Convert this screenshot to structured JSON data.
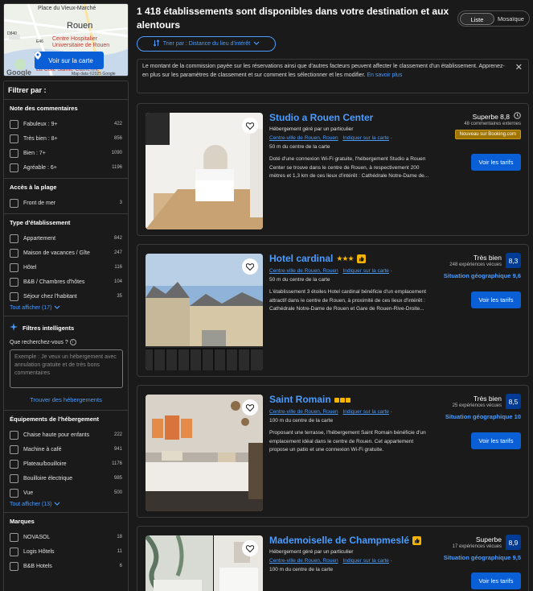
{
  "map": {
    "city": "Rouen",
    "labels": [
      "Place du Vieux-Marché",
      "Centre Hospitalier Universitaire de Rouen",
      "La Côte Sainte-Catherine",
      "Map data ©2025 Google",
      "Google",
      "D840",
      "E46"
    ],
    "button": "Voir sur la carte"
  },
  "header": {
    "title": "1 418 établissements sont disponibles dans votre destination et aux alentours",
    "view_list": "Liste",
    "view_grid": "Mosaïque",
    "sort": "Trier par : Distance du lieu d'intérêt"
  },
  "notice": {
    "text": "Le montant de la commission payée sur les réservations ainsi que d'autres facteurs peuvent affecter le classement d'un établissement. Apprenez-en plus sur les paramètres de classement et sur comment les sélectionner et les modifier.",
    "more": "En savoir plus"
  },
  "filters": {
    "title": "Filtrer par :",
    "reviews": {
      "title": "Note des commentaires",
      "items": [
        {
          "label": "Fabuleux : 9+",
          "count": "422"
        },
        {
          "label": "Très bien : 8+",
          "count": "856"
        },
        {
          "label": "Bien : 7+",
          "count": "1090"
        },
        {
          "label": "Agréable : 6+",
          "count": "1196"
        }
      ]
    },
    "beach": {
      "title": "Accès à la plage",
      "items": [
        {
          "label": "Front de mer",
          "count": "3"
        }
      ]
    },
    "type": {
      "title": "Type d'établissement",
      "items": [
        {
          "label": "Appartement",
          "count": "842"
        },
        {
          "label": "Maison de vacances / Gîte",
          "count": "247"
        },
        {
          "label": "Hôtel",
          "count": "116"
        },
        {
          "label": "B&B / Chambres d'hôtes",
          "count": "104"
        },
        {
          "label": "Séjour chez l'habitant",
          "count": "35"
        }
      ],
      "show_all": "Tout afficher (17)"
    },
    "smart": {
      "title": "Filtres intelligents",
      "question": "Que recherchez-vous ?",
      "placeholder": "Exemple : Je veux un hébergement avec annulation gratuite et de très bons commentaires",
      "find": "Trouver des hébergements"
    },
    "equipment": {
      "title": "Équipements de l'hébergement",
      "items": [
        {
          "label": "Chaise haute pour enfants",
          "count": "222"
        },
        {
          "label": "Machine à café",
          "count": "941"
        },
        {
          "label": "Plateau/bouilloire",
          "count": "1176"
        },
        {
          "label": "Bouilloire électrique",
          "count": "985"
        },
        {
          "label": "Vue",
          "count": "500"
        }
      ],
      "show_all": "Tout afficher (13)"
    },
    "brands": {
      "title": "Marques",
      "items": [
        {
          "label": "NOVASOL",
          "count": "18"
        },
        {
          "label": "Logis Hôtels",
          "count": "11"
        },
        {
          "label": "B&B Hotels",
          "count": "6"
        }
      ]
    }
  },
  "cards": [
    {
      "name": "Studio a Rouen Center",
      "subtitle": "Hébergement géré par un particulier",
      "area": "Centre-ville de Rouen, Rouen",
      "map_link": "Indiquer sur la carte",
      "distance": "50 m du centre de la carte",
      "description": "Doté d'une connexion Wi-Fi gratuite, l'hébergement Studio a Rouen Center se trouve dans le centre de Rouen, à respectivement 200 mètres et 1,3 km de ces lieux d'intérêt : Cathédrale Notre-Dame de...",
      "score_label": "Superbe 8,8",
      "votes": "48 commentaires externes",
      "badge": "Nouveau sur Booking.com",
      "button": "Voir les tarifs"
    },
    {
      "name": "Hotel cardinal",
      "area": "Centre-ville de Rouen, Rouen",
      "map_link": "Indiquer sur la carte",
      "distance": "50 m du centre de la carte",
      "description": "L'établissement 3 étoiles Hotel cardinal bénéficie d'un emplacement attractif dans le centre de Rouen, à proximité de ces lieux d'intérêt : Cathédrale Notre-Dame de Rouen et Gare de Rouen-Rive-Droite...",
      "score_label": "Très bien",
      "score": "8,3",
      "votes": "248 expériences vécues",
      "location": "Situation géographique 9,6",
      "button": "Voir les tarifs"
    },
    {
      "name": "Saint Romain",
      "area": "Centre-ville de Rouen, Rouen",
      "map_link": "Indiquer sur la carte",
      "distance": "100 m du centre de la carte",
      "description": "Proposant une terrasse, l'hébergement Saint Romain bénéficie d'un emplacement idéal dans le centre de Rouen. Cet appartement propose un patio et une connexion Wi-Fi gratuite.",
      "score_label": "Très bien",
      "score": "8,5",
      "votes": "25 expériences vécues",
      "location": "Situation géographique 10",
      "button": "Voir les tarifs"
    },
    {
      "name": "Mademoiselle de Champmeslé",
      "subtitle": "Hébergement géré par un particulier",
      "area": "Centre-ville de Rouen, Rouen",
      "map_link": "Indiquer sur la carte",
      "distance": "100 m du centre de la carte",
      "score_label": "Superbe",
      "score": "8,9",
      "votes": "17 expériences vécues",
      "location": "Situation géographique 9,5",
      "button": "Voir les tarifs"
    }
  ]
}
